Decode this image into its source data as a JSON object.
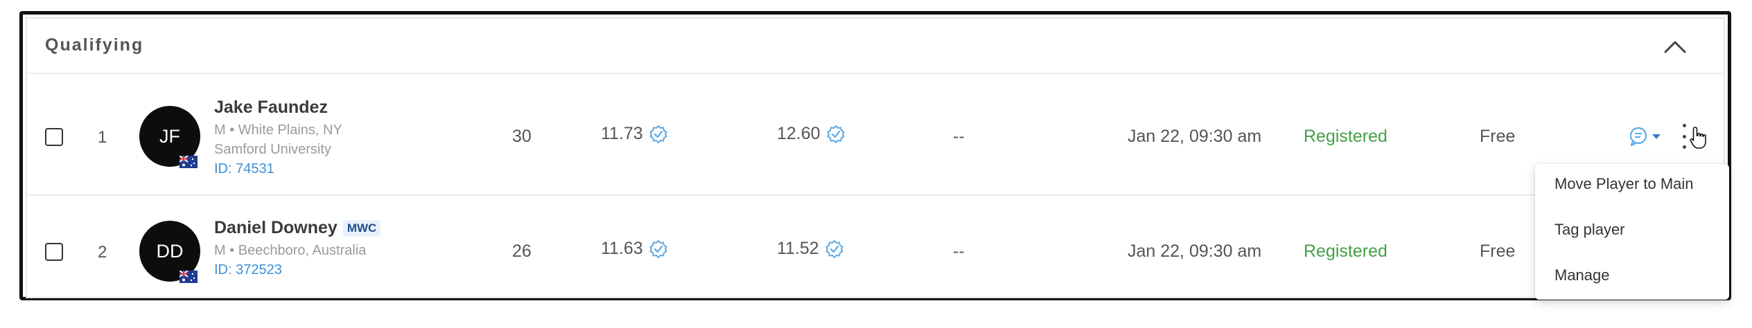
{
  "section": {
    "title": "Qualifying"
  },
  "players": [
    {
      "rank": "1",
      "initials": "JF",
      "name": "Jake Faundez",
      "badge": "",
      "meta_line1": "M • White Plains, NY",
      "meta_line2": "Samford University",
      "id_text": "ID: 74531",
      "age": "30",
      "rating1": "11.73",
      "rating2": "12.60",
      "extra": "--",
      "datetime": "Jan 22, 09:30 am",
      "status": "Registered",
      "fee": "Free"
    },
    {
      "rank": "2",
      "initials": "DD",
      "name": "Daniel Downey",
      "badge": "MWC",
      "meta_line1": "M • Beechboro, Australia",
      "meta_line2": "",
      "id_text": "ID: 372523",
      "age": "26",
      "rating1": "11.63",
      "rating2": "11.52",
      "extra": "--",
      "datetime": "Jan 22, 09:30 am",
      "status": "Registered",
      "fee": "Free"
    }
  ],
  "menu": {
    "items": [
      "Move Player to Main",
      "Tag player",
      "Manage"
    ]
  },
  "colors": {
    "status_registered": "#43a047",
    "id_link": "#3c8fd6",
    "verify_icon": "#5aa9e6",
    "avatar_bg": "#0d0d0d"
  },
  "icons": [
    "chevron-up-icon",
    "verified-badge-icon",
    "message-icon",
    "caret-down-icon",
    "more-vertical-icon",
    "australia-flag-icon",
    "pointer-cursor-icon"
  ]
}
